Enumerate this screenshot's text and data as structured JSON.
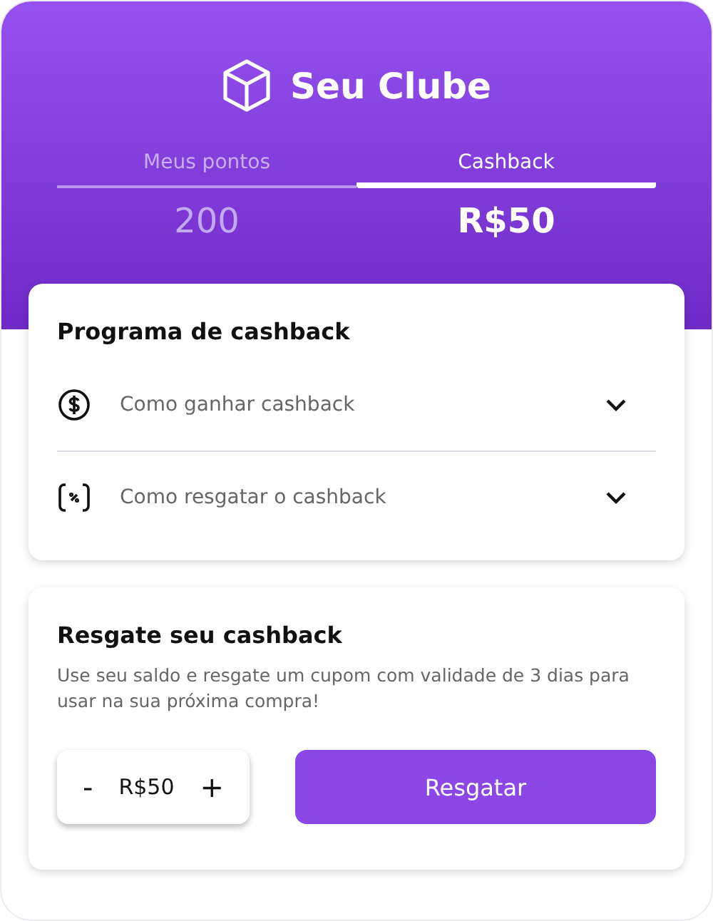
{
  "header": {
    "title": "Seu Clube"
  },
  "tabs": [
    {
      "label": "Meus pontos",
      "value": "200",
      "selected": false
    },
    {
      "label": "Cashback",
      "value": "R$50",
      "selected": true
    }
  ],
  "program_card": {
    "title": "Programa de cashback",
    "items": [
      {
        "kind": "dollar",
        "label": "Como ganhar cashback",
        "expanded": false
      },
      {
        "kind": "percent",
        "label": "Como resgatar o cashback",
        "expanded": false
      }
    ]
  },
  "redeem_card": {
    "title": "Resgate seu cashback",
    "description": "Use seu saldo e resgate um cupom com validade de 3 dias para usar na sua próxima compra!",
    "stepper": {
      "minus": "-",
      "value": "R$50",
      "plus": "+"
    },
    "button": "Resgatar"
  }
}
